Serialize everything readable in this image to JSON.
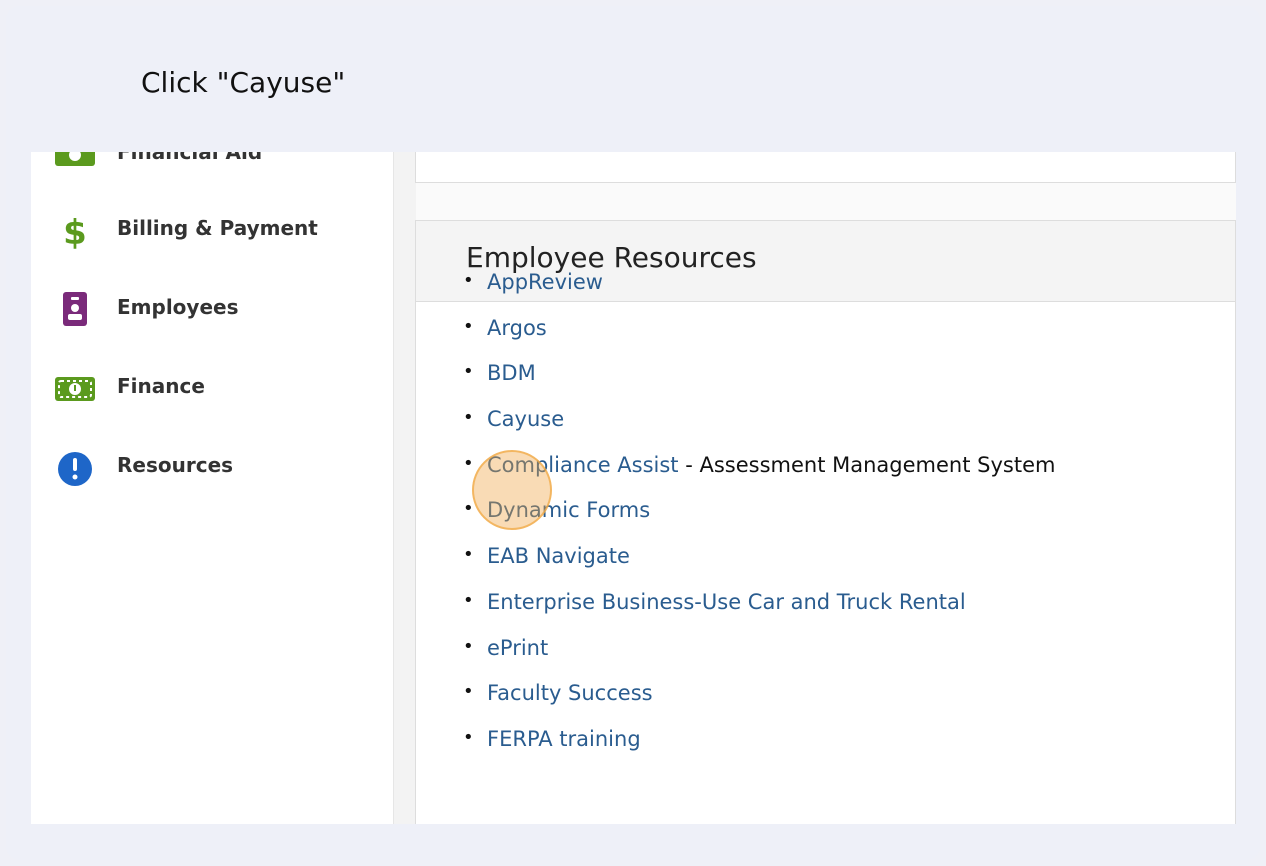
{
  "instruction": "Click \"Cayuse\"",
  "sidebar": {
    "items": [
      {
        "label": "Financial Aid",
        "icon": "money-icon",
        "color": "#5b9a1e"
      },
      {
        "label": "Billing & Payment",
        "icon": "dollar-icon",
        "color": "#5b9a1e"
      },
      {
        "label": "Employees",
        "icon": "id-badge-icon",
        "color": "#7a2a7a"
      },
      {
        "label": "Finance",
        "icon": "money-icon",
        "color": "#5b9a1e"
      },
      {
        "label": "Resources",
        "icon": "exclamation-icon",
        "color": "#1e66c8"
      }
    ]
  },
  "panel": {
    "title": "Employee Resources"
  },
  "resources": [
    {
      "label": "AppReview",
      "desc": ""
    },
    {
      "label": "Argos",
      "desc": ""
    },
    {
      "label": "BDM",
      "desc": ""
    },
    {
      "label": "Cayuse",
      "desc": ""
    },
    {
      "label": "Compliance Assist",
      "desc": " - Assessment Management System"
    },
    {
      "label": "Dynamic Forms",
      "desc": ""
    },
    {
      "label": "EAB Navigate",
      "desc": ""
    },
    {
      "label": "Enterprise Business-Use Car and Truck Rental",
      "desc": ""
    },
    {
      "label": "ePrint",
      "desc": ""
    },
    {
      "label": "Faculty Success",
      "desc": ""
    },
    {
      "label": "FERPA training",
      "desc": ""
    }
  ],
  "colors": {
    "link": "#2a5c8f",
    "highlight": "#f0a03c"
  }
}
